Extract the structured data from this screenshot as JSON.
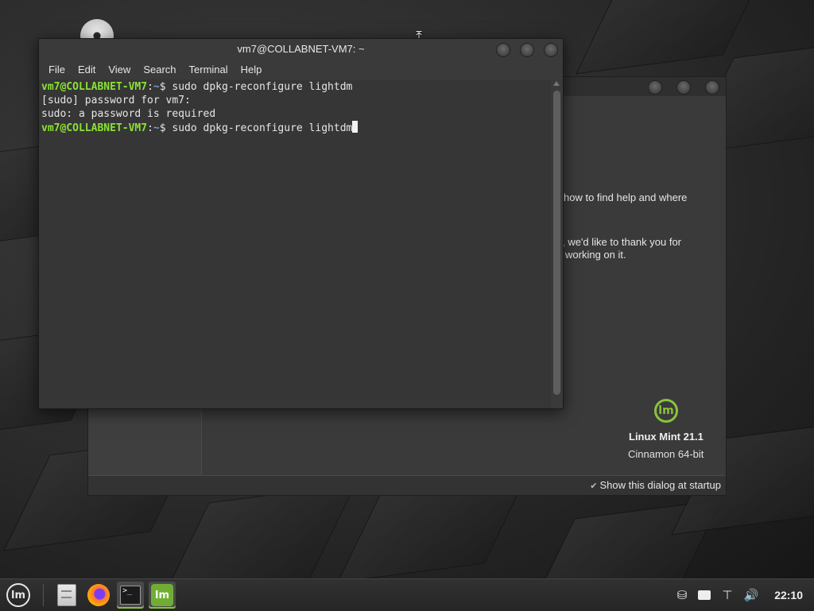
{
  "terminal": {
    "title": "vm7@COLLABNET-VM7: ~",
    "menu": [
      "File",
      "Edit",
      "View",
      "Search",
      "Terminal",
      "Help"
    ],
    "lines": [
      {
        "user": "vm7@COLLABNET-VM7",
        "path": "~",
        "symbol": "$",
        "command": "sudo dpkg-reconfigure lightdm"
      },
      {
        "text": "[sudo] password for vm7:"
      },
      {
        "text": "sudo: a password is required"
      },
      {
        "user": "vm7@COLLABNET-VM7",
        "path": "~",
        "symbol": "$",
        "command": "sudo dpkg-reconfigure lightdm"
      }
    ],
    "colors": {
      "user": "#8ae234",
      "path": "#729fcf"
    }
  },
  "welcome": {
    "text_line1": "how to find help and where",
    "text_line2": "ct, we'd like to thank you for",
    "text_line3": "working on it.",
    "version": "Linux Mint 21.1",
    "edition": "Cinnamon 64-bit",
    "show_at_startup": "Show this dialog at startup"
  },
  "panel": {
    "menu_icon": "linux-mint-logo-icon",
    "launchers": [
      "file-manager-icon",
      "firefox-icon",
      "terminal-icon",
      "mint-welcome-icon"
    ],
    "tray": [
      "network-manager-icon",
      "keyboard-icon",
      "network-wired-icon",
      "volume-icon"
    ],
    "clock": "22:10"
  },
  "accent": "#8ac33d"
}
